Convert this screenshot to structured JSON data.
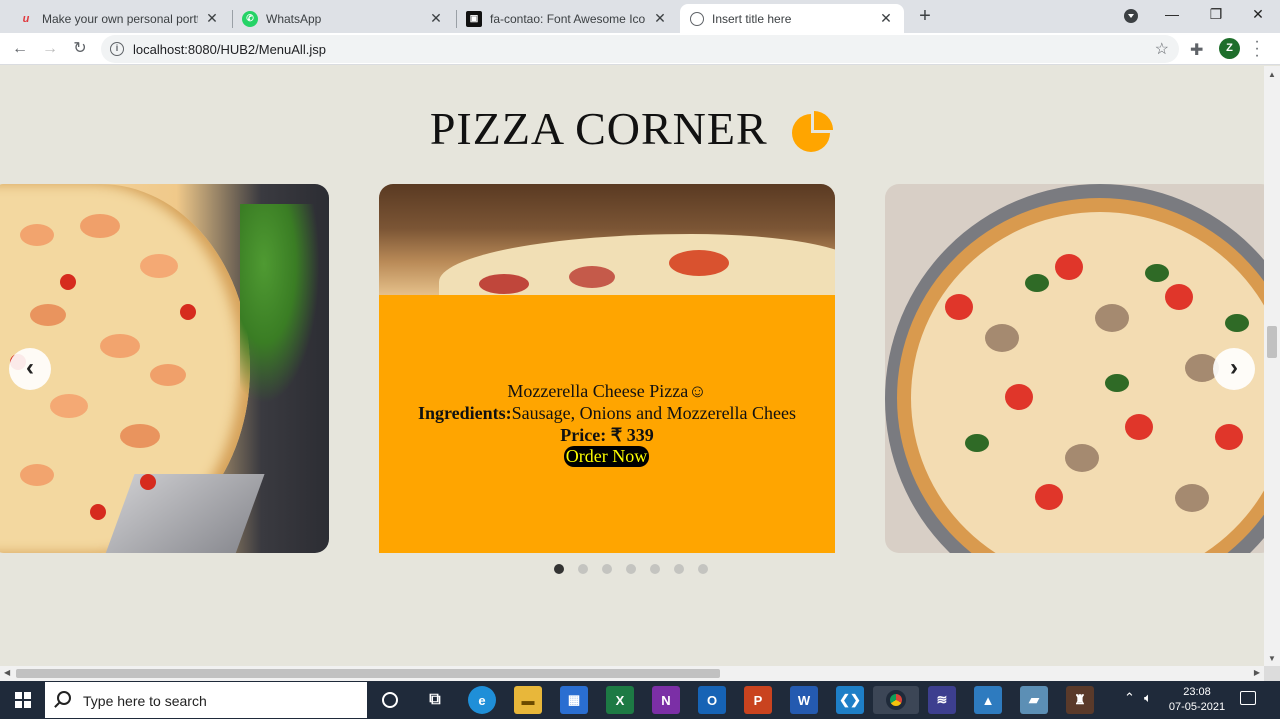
{
  "browser": {
    "tabs": [
      {
        "title": "Make your own personal portfoli",
        "favicon": "u-logo-icon"
      },
      {
        "title": "WhatsApp",
        "favicon": "whatsapp-icon"
      },
      {
        "title": "fa-contao: Font Awesome Icons",
        "favicon": "contao-icon"
      },
      {
        "title": "Insert title here",
        "favicon": "globe-icon",
        "active": true
      }
    ],
    "url": "localhost:8080/HUB2/MenuAll.jsp",
    "profile_initial": "Z"
  },
  "page": {
    "heading": "PIZZA CORNER",
    "heading_icon": "pie-chart-icon",
    "carousel": {
      "active_index": 0,
      "slide_count": 7,
      "center_item": {
        "name": "Mozzerella Cheese Pizza",
        "emoji": "☺",
        "ingredients_label": "Ingredients:",
        "ingredients": "Sausage, Onions and Mozzerella Chees",
        "price_label": "Price:",
        "currency": "₹",
        "price": "339",
        "order_label": "Order Now"
      }
    }
  },
  "taskbar": {
    "search_placeholder": "Type here to search",
    "time": "23:08",
    "date": "07-05-2021"
  }
}
